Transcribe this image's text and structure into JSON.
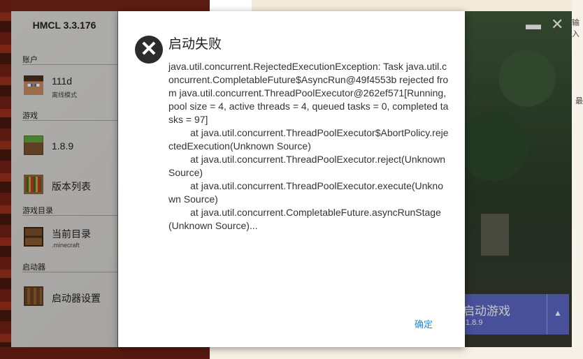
{
  "app": {
    "title": "HMCL 3.3.176"
  },
  "sidebar": {
    "sections": {
      "account": "账户",
      "game": "游戏",
      "game_dir": "游戏目录",
      "launcher": "启动器"
    },
    "items": [
      {
        "label": "111d",
        "sub": "离线模式",
        "icon": "steve-head-icon"
      },
      {
        "label": "1.8.9",
        "icon": "grass-block-icon"
      },
      {
        "label": "版本列表",
        "icon": "bookshelf-icon"
      },
      {
        "label": "当前目录",
        "sub": ".minecraft",
        "icon": "chest-icon"
      },
      {
        "label": "启动器设置",
        "icon": "crafting-table-icon"
      }
    ]
  },
  "window_controls": {
    "minimize": "▬",
    "close": "✕"
  },
  "launch": {
    "label": "启动游戏",
    "version": "1.8.9",
    "menu_icon": "▲"
  },
  "dialog": {
    "title": "启动失败",
    "icon": "✕",
    "message": "java.util.concurrent.RejectedExecutionException: Task java.util.concurrent.CompletableFuture$AsyncRun@49f4553b rejected from java.util.concurrent.ThreadPoolExecutor@262ef571[Running, pool size = 4, active threads = 4, queued tasks = 0, completed tasks = 97]\n\tat java.util.concurrent.ThreadPoolExecutor$AbortPolicy.rejectedExecution(Unknown Source)\n\tat java.util.concurrent.ThreadPoolExecutor.reject(Unknown Source)\n\tat java.util.concurrent.ThreadPoolExecutor.execute(Unknown Source)\n\tat java.util.concurrent.CompletableFuture.asyncRunStage(Unknown Source)...",
    "ok_label": "确定"
  },
  "background": {
    "snippet_1": "输入",
    "snippet_2": "最"
  },
  "colors": {
    "accent": "#1e88e5",
    "launch": "#5b67c4",
    "error_icon": "#2b2b2b"
  }
}
